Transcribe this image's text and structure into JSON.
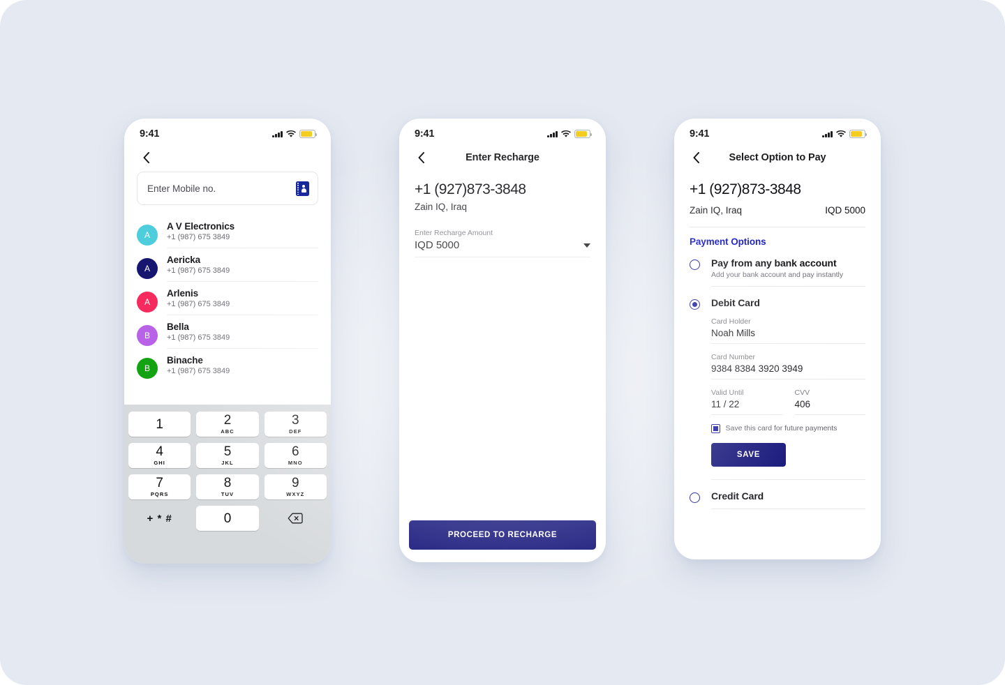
{
  "theme": {
    "canvas_bg": "#e5e9f1",
    "brand_navy": "#111178",
    "accent_blue": "#1418c4",
    "keypad_bg": "#d7dadd"
  },
  "status_bar": {
    "time": "9:41",
    "signal_icon": "cellular-signal-icon",
    "wifi_icon": "wifi-icon",
    "battery_icon": "battery-icon"
  },
  "screen1": {
    "back_icon": "back-chevron-icon",
    "search": {
      "placeholder": "Enter Mobile no.",
      "value": "",
      "trailing_icon": "contact-book-icon"
    },
    "contacts": [
      {
        "initial": "A",
        "name": "A V Electronics",
        "phone": "+1 (987) 675 3849",
        "color": "#4ecddd"
      },
      {
        "initial": "A",
        "name": "Aericka",
        "phone": "+1 (987) 675 3849",
        "color": "#161670"
      },
      {
        "initial": "A",
        "name": "Arlenis",
        "phone": "+1 (987) 675 3849",
        "color": "#f72a5e"
      },
      {
        "initial": "B",
        "name": "Bella",
        "phone": "+1 (987) 675 3849",
        "color": "#b862e8"
      },
      {
        "initial": "B",
        "name": "Binache",
        "phone": "+1 (987) 675 3849",
        "color": "#13a312"
      }
    ],
    "keypad": [
      {
        "num": "1",
        "sub": ""
      },
      {
        "num": "2",
        "sub": "ABC"
      },
      {
        "num": "3",
        "sub": "DEF"
      },
      {
        "num": "4",
        "sub": "GHI"
      },
      {
        "num": "5",
        "sub": "JKL"
      },
      {
        "num": "6",
        "sub": "MNO"
      },
      {
        "num": "7",
        "sub": "PQRS"
      },
      {
        "num": "8",
        "sub": "TUV"
      },
      {
        "num": "9",
        "sub": "WXYZ"
      },
      {
        "num": "+ * #",
        "sub": ""
      },
      {
        "num": "0",
        "sub": ""
      },
      {
        "num": "",
        "sub": "",
        "icon": "backspace-icon"
      }
    ]
  },
  "screen2": {
    "title": "Enter Recharge",
    "back_icon": "back-chevron-icon",
    "phone_number": "+1 (927)873-3848",
    "carrier": "Zain IQ, Iraq",
    "amount_label": "Enter Recharge Amount",
    "amount_value": "IQD 5000",
    "dropdown_icon": "caret-down-icon",
    "cta_label": "PROCEED TO RECHARGE"
  },
  "screen3": {
    "title": "Select Option to Pay",
    "back_icon": "back-chevron-icon",
    "phone_number": "+1 (927)873-3848",
    "carrier": "Zain IQ, Iraq",
    "amount": "IQD 5000",
    "section_title": "Payment Options",
    "option_bank": {
      "title": "Pay from any bank account",
      "subtitle": "Add your bank account and pay instantly",
      "selected": false
    },
    "option_debit": {
      "title": "Debit Card",
      "selected": true,
      "card_holder_label": "Card Holder",
      "card_holder_value": "Noah Mills",
      "card_number_label": "Card Number",
      "card_number_value": "9384 8384 3920 3949",
      "valid_until_label": "Valid Until",
      "valid_until_value": "11 / 22",
      "cvv_label": "CVV",
      "cvv_value": "406",
      "save_card_label": "Save this card for future payments",
      "save_card_checked": true,
      "save_button_label": "SAVE"
    },
    "option_credit": {
      "title": "Credit Card",
      "selected": false
    }
  }
}
